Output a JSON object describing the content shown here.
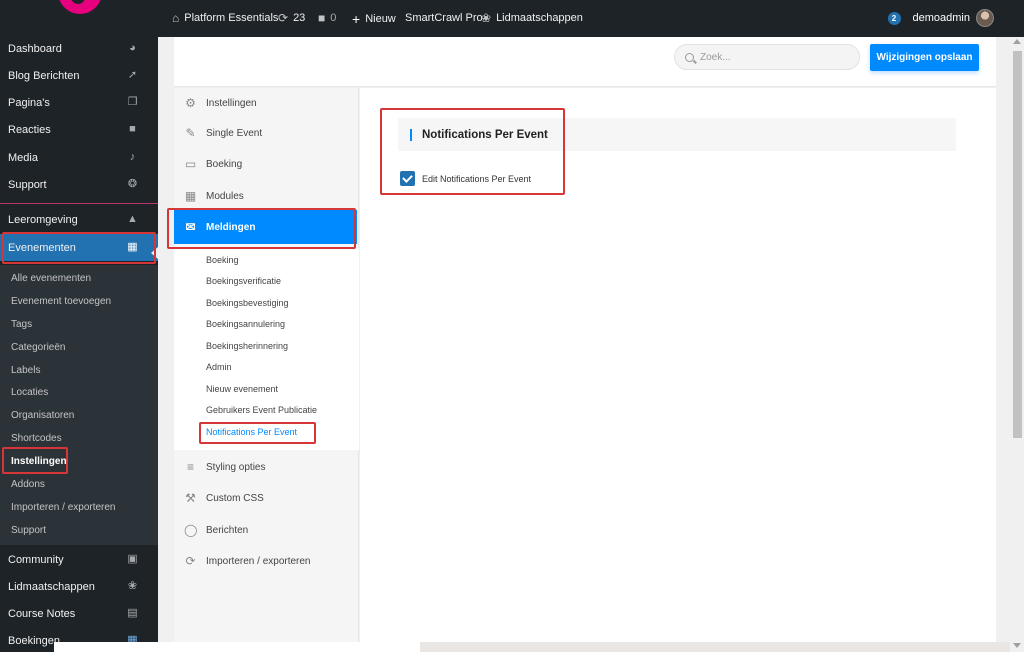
{
  "adminbar": {
    "items": [
      {
        "icon": "home-icon",
        "label": "Platform Essentials"
      },
      {
        "icon": "updates-icon",
        "label": "23"
      },
      {
        "icon": "comment-icon",
        "label": "0"
      },
      {
        "icon": "plus-icon",
        "label": "Nieuw"
      },
      {
        "icon": "",
        "label": "SmartCrawl Pro"
      },
      {
        "icon": "groups-icon",
        "label": "Lidmaatschappen"
      }
    ],
    "notification_count": "2",
    "username": "demoadmin"
  },
  "sidebar": {
    "items": [
      {
        "label": "Dashboard",
        "icon": "dashboard-icon"
      },
      {
        "label": "Blog Berichten",
        "icon": "pin-icon"
      },
      {
        "label": "Pagina's",
        "icon": "pages-icon"
      },
      {
        "label": "Reacties",
        "icon": "comments-icon"
      },
      {
        "label": "Media",
        "icon": "media-icon"
      },
      {
        "label": "Support",
        "icon": "lifebuoy-icon"
      },
      {
        "label": "Leeromgeving",
        "icon": "graduation-cap-icon"
      },
      {
        "label": "Evenementen",
        "icon": "calendar-icon"
      }
    ],
    "submenu": [
      "Alle evenementen",
      "Evenement toevoegen",
      "Tags",
      "Categorieën",
      "Labels",
      "Locaties",
      "Organisatoren",
      "Shortcodes",
      "Instellingen",
      "Addons",
      "Importeren / exporteren",
      "Support"
    ],
    "bottom_items": [
      {
        "label": "Community",
        "icon": "community-icon"
      },
      {
        "label": "Lidmaatschappen",
        "icon": "groups-icon"
      },
      {
        "label": "Course Notes",
        "icon": "notes-icon"
      },
      {
        "label": "Boekingen",
        "icon": "booking-icon"
      }
    ]
  },
  "header": {
    "search_placeholder": "Zoek...",
    "save_label": "Wijzigingen opslaan"
  },
  "settings_nav": {
    "items": [
      {
        "label": "Instellingen",
        "icon": "gear-icon"
      },
      {
        "label": "Single Event",
        "icon": "edit-icon"
      },
      {
        "label": "Boeking",
        "icon": "card-icon"
      },
      {
        "label": "Modules",
        "icon": "grid-icon"
      },
      {
        "label": "Meldingen",
        "icon": "envelope-icon"
      }
    ],
    "sub_items": [
      "Boeking",
      "Boekingsverificatie",
      "Boekingsbevestiging",
      "Boekingsannulering",
      "Boekingsherinnering",
      "Admin",
      "Nieuw evenement",
      "Gebruikers Event Publicatie",
      "Notifications Per Event"
    ],
    "bottom_items": [
      {
        "label": "Styling opties",
        "icon": "sliders-icon"
      },
      {
        "label": "Custom CSS",
        "icon": "wrench-icon"
      },
      {
        "label": "Berichten",
        "icon": "speech-bubble-icon"
      },
      {
        "label": "Importeren / exporteren",
        "icon": "sync-icon"
      }
    ]
  },
  "main": {
    "section_title": "Notifications Per Event",
    "checkbox_label": "Edit Notifications Per Event",
    "checkbox_checked": true
  },
  "colors": {
    "accent": "#008aff",
    "wp_blue": "#2271b1",
    "highlight": "#d63638",
    "sidebar_bg": "#1d2327"
  }
}
